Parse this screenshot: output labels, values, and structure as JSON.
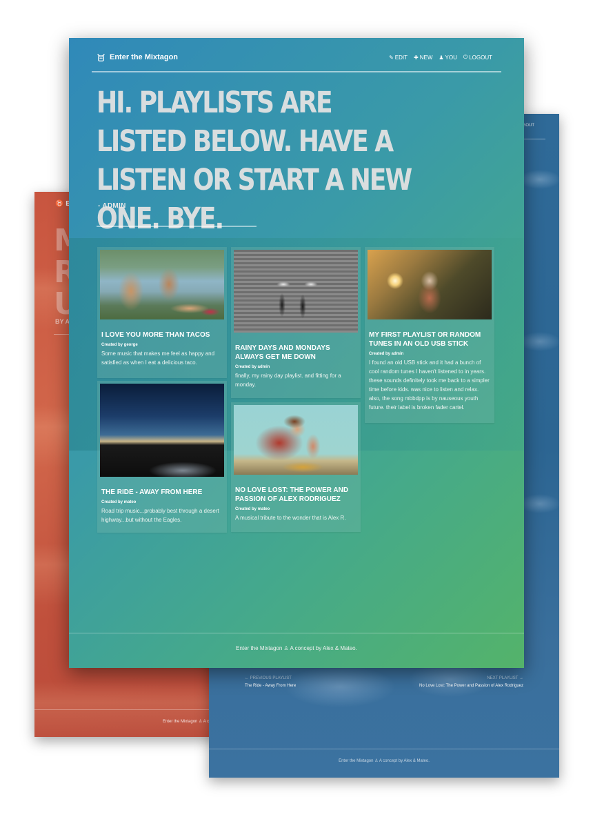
{
  "site": {
    "brand": "Enter the Mixtagon",
    "nav": [
      {
        "icon": "pencil-icon",
        "label": "EDIT"
      },
      {
        "icon": "plus-icon",
        "label": "NEW"
      },
      {
        "icon": "user-icon",
        "label": "YOU"
      },
      {
        "icon": "power-icon",
        "label": "LOGOUT"
      }
    ]
  },
  "hero": {
    "heading": "HI. PLAYLISTS ARE LISTED BELOW. HAVE A LISTEN OR START A NEW ONE. BYE.",
    "byline": "- ADMIN"
  },
  "playlists": [
    {
      "title": "I LOVE YOU MORE THAN TACOS",
      "author": "Created by george",
      "description": "Some music that makes me feel as happy and satisfied as when I eat a delicious taco."
    },
    {
      "title": "RAINY DAYS AND MONDAYS ALWAYS GET ME DOWN",
      "author": "Created by admin",
      "description": "finally, my rainy day playlist. and fitting for a monday."
    },
    {
      "title": "MY FIRST PLAYLIST OR RANDOM TUNES IN AN OLD USB STICK",
      "author": "Created by admin",
      "description": "I found an old USB stick and it had a bunch of cool random tunes I haven't listened to in years. these sounds definitely took me back to a simpler time before kids. was nice to listen and relax. also, the song mbbdpp is by nauseous youth future. their label is broken fader cartel."
    },
    {
      "title": "THE RIDE - AWAY FROM HERE",
      "author": "Created by mateo",
      "description": "Road trip music...probably best through a desert highway...but without the Eagles."
    },
    {
      "title": "NO LOVE LOST: THE POWER AND PASSION OF ALEX RODRIGUEZ",
      "author": "Created by mateo",
      "description": "A musical tribute to the wonder that is Alex R."
    }
  ],
  "footer": "Enter the Mixtagon ♙ A concept by Alex & Mateo.",
  "background_pages": {
    "red": {
      "brand_initial": "E",
      "heading": "M\nR\nU",
      "byline": "BY A",
      "footer": "Enter the Mixtagon ♙ A c"
    },
    "blue": {
      "logout": "GOUT",
      "previous_label": "← PREVIOUS PLAYLIST",
      "previous_title": "The Ride - Away From Here",
      "next_label": "NEXT PLAYLIST →",
      "next_title": "No Love Lost: The Power and Passion of Alex Rodriguez",
      "footer": "Enter the Mixtagon ♙ A concept by Alex & Mateo."
    }
  },
  "colors": {
    "main_gradient_start": "#3089b9",
    "main_gradient_end": "#54b36a",
    "red_page": "#c8553f",
    "blue_page": "#2f6a98"
  }
}
